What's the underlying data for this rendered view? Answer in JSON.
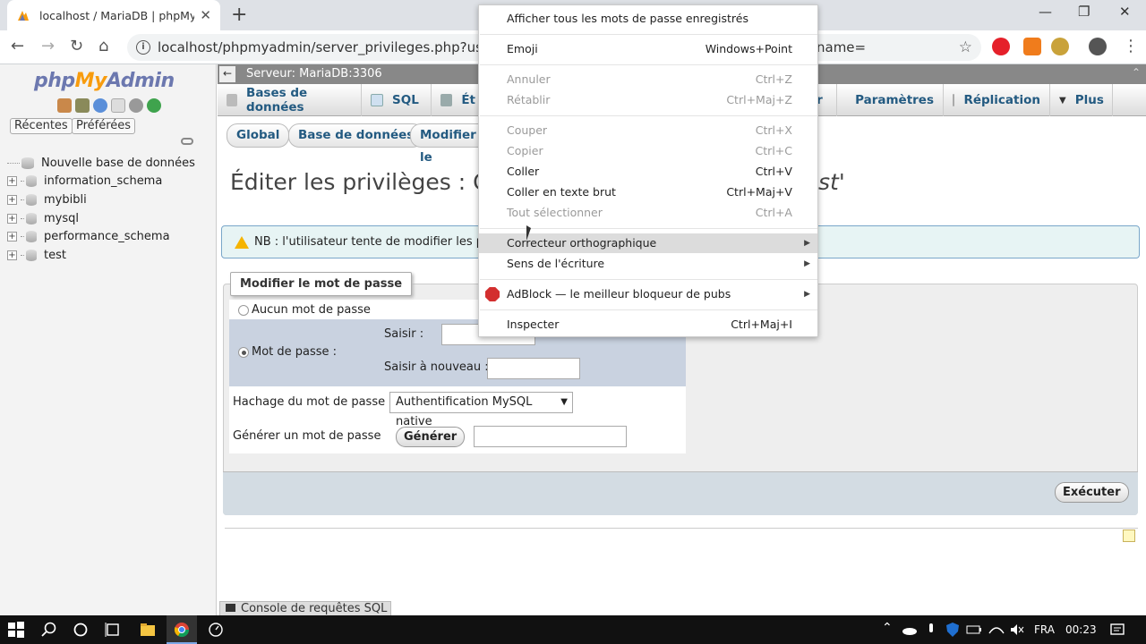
{
  "browser": {
    "tab_title": "localhost / MariaDB | phpMyAdm",
    "tab_close": "✕",
    "new_tab": "+",
    "url": "localhost/phpmyadmin/server_privileges.php?username=r",
    "url_tail": "name=",
    "back": "←",
    "forward": "→",
    "reload": "↻",
    "home": "⌂",
    "star": "☆",
    "menu": "⋮",
    "minimize": "—",
    "restore": "❐",
    "close": "✕"
  },
  "left_panel": {
    "logo_php": "php",
    "logo_my": "My",
    "logo_admin": "Admin",
    "recent_label": "Récentes",
    "favorites_label": "Préférées",
    "new_db_label": "Nouvelle base de données",
    "databases": [
      "information_schema",
      "mybibli",
      "mysql",
      "performance_schema",
      "test"
    ]
  },
  "server_bar": {
    "back": "←",
    "label": "Serveur: MariaDB:3306",
    "collapse": "⌃"
  },
  "top_menu": {
    "items": [
      "Bases de données",
      "SQL",
      "Ét",
      "er",
      "Paramètres",
      "Réplication",
      "Plus"
    ]
  },
  "subtabs": [
    "Global",
    "Base de données",
    "Modifier le"
  ],
  "page": {
    "title": "Éditer les privilèges : Co",
    "title_tail": "st'",
    "notice": "NB : l'utilisateur tente de modifier les privilè"
  },
  "form": {
    "legend": "Modifier le mot de passe",
    "no_password_label": "Aucun mot de passe",
    "password_label": "Mot de passe :",
    "enter_label": "Saisir :",
    "reenter_label": "Saisir à nouveau :",
    "hashing_label": "Hachage du mot de passe :",
    "hashing_value": "Authentification MySQL native",
    "generate_label": "Générer un mot de passe",
    "generate_button": "Générer",
    "execute_button": "Exécuter"
  },
  "console": {
    "label": "Console de requêtes SQL"
  },
  "context_menu": {
    "items": [
      {
        "label": "Afficher tous les mots de passe enregistrés",
        "shortcut": "",
        "disabled": false
      },
      {
        "label": "Emoji",
        "shortcut": "Windows+Point",
        "disabled": false
      },
      {
        "label": "Annuler",
        "shortcut": "Ctrl+Z",
        "disabled": true
      },
      {
        "label": "Rétablir",
        "shortcut": "Ctrl+Maj+Z",
        "disabled": true
      },
      {
        "label": "Couper",
        "shortcut": "Ctrl+X",
        "disabled": true
      },
      {
        "label": "Copier",
        "shortcut": "Ctrl+C",
        "disabled": true
      },
      {
        "label": "Coller",
        "shortcut": "Ctrl+V",
        "disabled": false
      },
      {
        "label": "Coller en texte brut",
        "shortcut": "Ctrl+Maj+V",
        "disabled": false
      },
      {
        "label": "Tout sélectionner",
        "shortcut": "Ctrl+A",
        "disabled": true
      },
      {
        "label": "Correcteur orthographique",
        "shortcut": "",
        "disabled": false,
        "submenu": true
      },
      {
        "label": "Sens de l'écriture",
        "shortcut": "",
        "disabled": false,
        "submenu": true
      },
      {
        "label": "AdBlock — le meilleur bloqueur de pubs",
        "shortcut": "",
        "disabled": false,
        "submenu": true
      },
      {
        "label": "Inspecter",
        "shortcut": "Ctrl+Maj+I",
        "disabled": false
      }
    ],
    "submenu_arrow": "▶"
  },
  "taskbar": {
    "language": "FRA",
    "time": "00:23"
  },
  "colors": {
    "pma_link": "#235a81",
    "adblock": "#d32f2f",
    "taskbar": "#111111"
  }
}
